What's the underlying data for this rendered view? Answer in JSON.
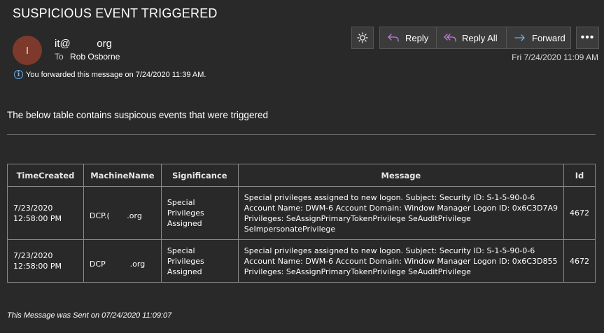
{
  "email": {
    "subject": "SUSPICIOUS EVENT TRIGGERED",
    "avatar_initial": "I",
    "sender": "it@         org",
    "to_label": "To",
    "to_name": "Rob Osborne",
    "forwarded_notice": "You forwarded this message on 7/24/2020 11:39 AM.",
    "date": "Fri 7/24/2020 11:09 AM"
  },
  "toolbar": {
    "theme_icon": "sun-icon",
    "reply_label": "Reply",
    "reply_all_label": "Reply All",
    "forward_label": "Forward",
    "more_label": "•••"
  },
  "body": {
    "intro": "The below table contains suspicous events that were triggered",
    "table": {
      "headers": [
        "TimeCreated",
        "MachineName",
        "Significance",
        "Message",
        "Id"
      ],
      "rows": [
        {
          "time_line1": "7/23/2020",
          "time_line2": "12:58:00 PM",
          "machine": "DCP.(       .org",
          "significance_1": "Special",
          "significance_2": "Privileges",
          "significance_3": "Assigned",
          "message": "Special privileges assigned to new logon. Subject: Security ID: S-1-5-90-0-6 Account Name: DWM-6 Account Domain: Window Manager Logon ID: 0x6C3D7A9 Privileges: SeAssignPrimaryTokenPrivilege SeAuditPrivilege SeImpersonatePrivilege",
          "id": "4672"
        },
        {
          "time_line1": "7/23/2020",
          "time_line2": "12:58:00 PM",
          "machine": "DCP          .org",
          "significance_1": "Special",
          "significance_2": "Privileges",
          "significance_3": "Assigned",
          "message": "Special privileges assigned to new logon. Subject: Security ID: S-1-5-90-0-6 Account Name: DWM-6 Account Domain: Window Manager Logon ID: 0x6C3D855 Privileges: SeAssignPrimaryTokenPrivilege SeAuditPrivilege",
          "id": "4672"
        }
      ]
    },
    "footer": "This Message was Sent on 07/24/2020 11:09:07"
  }
}
